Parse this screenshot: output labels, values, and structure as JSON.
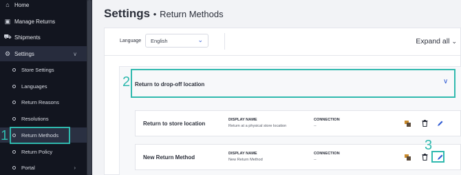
{
  "sidebar": {
    "items": [
      {
        "label": "Home",
        "icon": "home-icon"
      },
      {
        "label": "Manage Returns",
        "icon": "returns-icon"
      },
      {
        "label": "Shipments",
        "icon": "shipments-icon"
      },
      {
        "label": "Settings",
        "icon": "gear-icon"
      }
    ],
    "settings_sub": [
      {
        "label": "Store Settings"
      },
      {
        "label": "Languages"
      },
      {
        "label": "Return Reasons"
      },
      {
        "label": "Resolutions"
      },
      {
        "label": "Return Methods"
      },
      {
        "label": "Return Policy"
      },
      {
        "label": "Portal"
      }
    ]
  },
  "page": {
    "title": "Settings",
    "separator": "•",
    "subtitle": "Return Methods"
  },
  "toolbar": {
    "language_label": "Language",
    "language_value": "English",
    "expand_all_label": "Expand all"
  },
  "group": {
    "title": "Return to drop-off location"
  },
  "rows": [
    {
      "name": "Return to store location",
      "display_name_label": "DISPLAY NAME",
      "display_name": "Return at a physical store location",
      "connection_label": "CONNECTION",
      "connection": "--"
    },
    {
      "name": "New Return Method",
      "display_name_label": "DISPLAY NAME",
      "display_name": "New Return Method",
      "connection_label": "CONNECTION",
      "connection": "--"
    }
  ],
  "annotations": {
    "step1": "1",
    "step2": "2",
    "step3": "3"
  },
  "colors": {
    "sidebar_bg": "#12151f",
    "accent_blue": "#2f5bd3",
    "highlight_teal": "#2fb9ae",
    "delete_icon": "#2b2f3a",
    "copy_orange": "#c98a2c"
  }
}
